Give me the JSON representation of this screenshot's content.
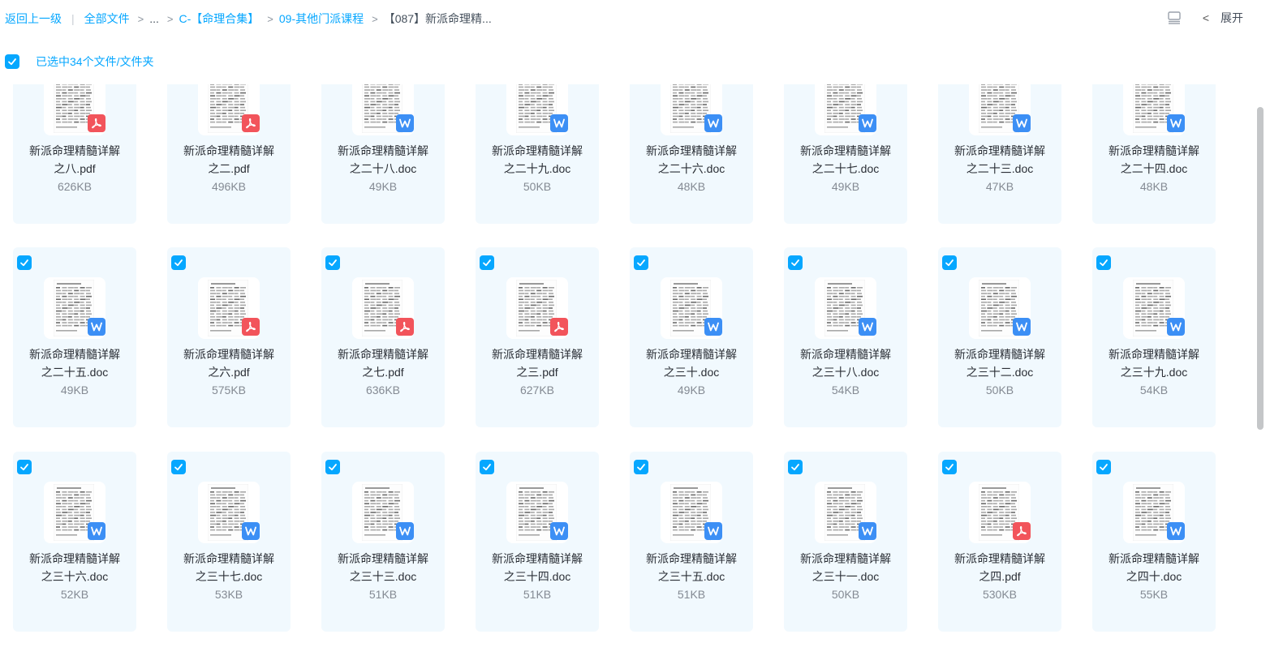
{
  "breadcrumb": {
    "back": "返回上一级",
    "all_files": "全部文件",
    "ellipsis": "...",
    "c_folder": "C-【命理合集】",
    "school_folder": "09-其他门派课程",
    "current": "【087】新派命理精..."
  },
  "toolbar": {
    "expand_label": "展开",
    "accent": "#06a7ff"
  },
  "selection": {
    "text": "已选中34个文件/文件夹"
  },
  "files": [
    {
      "line1": "新派命理精髓详解",
      "line2": "之八.pdf",
      "size": "626KB",
      "type": "pdf",
      "checked": false
    },
    {
      "line1": "新派命理精髓详解",
      "line2": "之二.pdf",
      "size": "496KB",
      "type": "pdf",
      "checked": false
    },
    {
      "line1": "新派命理精髓详解",
      "line2": "之二十八.doc",
      "size": "49KB",
      "type": "doc",
      "checked": false
    },
    {
      "line1": "新派命理精髓详解",
      "line2": "之二十九.doc",
      "size": "50KB",
      "type": "doc",
      "checked": false
    },
    {
      "line1": "新派命理精髓详解",
      "line2": "之二十六.doc",
      "size": "48KB",
      "type": "doc",
      "checked": false
    },
    {
      "line1": "新派命理精髓详解",
      "line2": "之二十七.doc",
      "size": "49KB",
      "type": "doc",
      "checked": false
    },
    {
      "line1": "新派命理精髓详解",
      "line2": "之二十三.doc",
      "size": "47KB",
      "type": "doc",
      "checked": false
    },
    {
      "line1": "新派命理精髓详解",
      "line2": "之二十四.doc",
      "size": "48KB",
      "type": "doc",
      "checked": false
    },
    {
      "line1": "新派命理精髓详解",
      "line2": "之二十五.doc",
      "size": "49KB",
      "type": "doc",
      "checked": true
    },
    {
      "line1": "新派命理精髓详解",
      "line2": "之六.pdf",
      "size": "575KB",
      "type": "pdf",
      "checked": true
    },
    {
      "line1": "新派命理精髓详解",
      "line2": "之七.pdf",
      "size": "636KB",
      "type": "pdf",
      "checked": true
    },
    {
      "line1": "新派命理精髓详解",
      "line2": "之三.pdf",
      "size": "627KB",
      "type": "pdf",
      "checked": true
    },
    {
      "line1": "新派命理精髓详解",
      "line2": "之三十.doc",
      "size": "49KB",
      "type": "doc",
      "checked": true
    },
    {
      "line1": "新派命理精髓详解",
      "line2": "之三十八.doc",
      "size": "54KB",
      "type": "doc",
      "checked": true
    },
    {
      "line1": "新派命理精髓详解",
      "line2": "之三十二.doc",
      "size": "50KB",
      "type": "doc",
      "checked": true
    },
    {
      "line1": "新派命理精髓详解",
      "line2": "之三十九.doc",
      "size": "54KB",
      "type": "doc",
      "checked": true
    },
    {
      "line1": "新派命理精髓详解",
      "line2": "之三十六.doc",
      "size": "52KB",
      "type": "doc",
      "checked": true
    },
    {
      "line1": "新派命理精髓详解",
      "line2": "之三十七.doc",
      "size": "53KB",
      "type": "doc",
      "checked": true
    },
    {
      "line1": "新派命理精髓详解",
      "line2": "之三十三.doc",
      "size": "51KB",
      "type": "doc",
      "checked": true
    },
    {
      "line1": "新派命理精髓详解",
      "line2": "之三十四.doc",
      "size": "51KB",
      "type": "doc",
      "checked": true
    },
    {
      "line1": "新派命理精髓详解",
      "line2": "之三十五.doc",
      "size": "51KB",
      "type": "doc",
      "checked": true
    },
    {
      "line1": "新派命理精髓详解",
      "line2": "之三十一.doc",
      "size": "50KB",
      "type": "doc",
      "checked": true
    },
    {
      "line1": "新派命理精髓详解",
      "line2": "之四.pdf",
      "size": "530KB",
      "type": "pdf",
      "checked": true
    },
    {
      "line1": "新派命理精髓详解",
      "line2": "之四十.doc",
      "size": "55KB",
      "type": "doc",
      "checked": true
    }
  ]
}
